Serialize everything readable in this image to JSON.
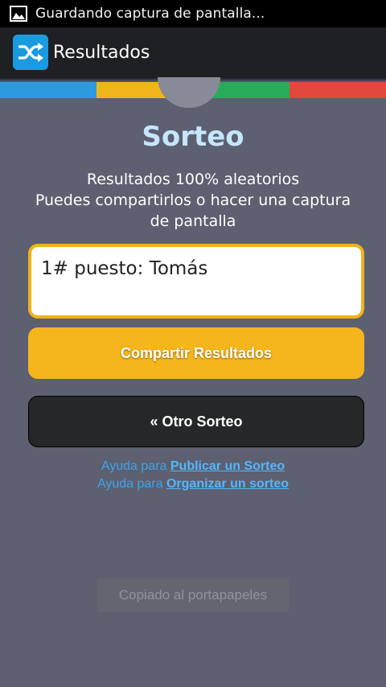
{
  "status_bar": {
    "notification_text": "Guardando captura de pantalla..."
  },
  "action_bar": {
    "title": "Resultados",
    "icon": "shuffle-icon"
  },
  "colors": {
    "strip": [
      "#2c9ae0",
      "#f1b51c",
      "#27ad59",
      "#e2483d"
    ],
    "accent": "#f5b51d",
    "title": "#c6e6ff",
    "link": "#54b6ff"
  },
  "main": {
    "title": "Sorteo",
    "description_line1": "Resultados 100% aleatorios",
    "description_line2": "Puedes compartirlos o hacer una captura de pantalla",
    "result_text": "1# puesto: Tomás",
    "share_button": "Compartir Resultados",
    "other_button": "« Otro Sorteo",
    "help1_prefix": "Ayuda para ",
    "help1_link": "Publicar un Sorteo",
    "help2_prefix": "Ayuda para ",
    "help2_link": "Organizar un sorteo"
  },
  "toast": {
    "text": "Copiado al portapapeles"
  }
}
